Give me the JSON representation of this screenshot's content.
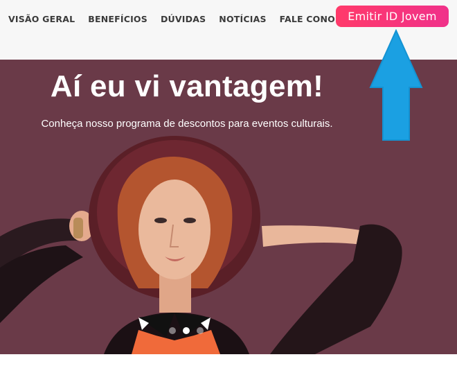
{
  "nav": {
    "items": [
      {
        "label": "VISÃO GERAL"
      },
      {
        "label": "BENEFÍCIOS"
      },
      {
        "label": "DÚVIDAS"
      },
      {
        "label": "NOTÍCIAS"
      },
      {
        "label": "FALE CONOSCO"
      }
    ],
    "cta_label": "Emitir ID Jovem"
  },
  "hero": {
    "title": "Aí eu vi vantagem!",
    "subtitle": "Conheça nosso programa de descontos para eventos culturais.",
    "carousel": {
      "slide_count": 3,
      "active_index": 1
    }
  },
  "annotation": {
    "icon": "arrow-up-icon",
    "color": "#1ba0e2"
  },
  "colors": {
    "nav_bg": "#f7f7f7",
    "hero_bg": "#6a3a48",
    "cta_gradient_start": "#ff3a6a",
    "cta_gradient_end": "#f0318a"
  }
}
